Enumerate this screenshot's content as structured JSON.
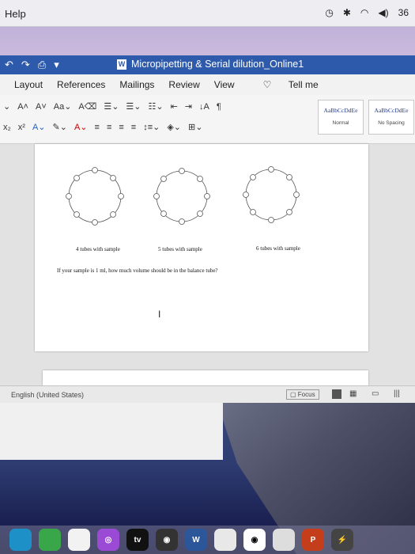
{
  "menubar": {
    "help": "Help",
    "battery": "36"
  },
  "titlebar": {
    "title": "Micropipetting & Serial dilution_Online1"
  },
  "tabs": [
    "Layout",
    "References",
    "Mailings",
    "Review",
    "View",
    "Tell me"
  ],
  "styles": [
    {
      "preview": "AaBbCcDdEe",
      "label": "Normal"
    },
    {
      "preview": "AaBbCcDdEe",
      "label": "No Spacing"
    }
  ],
  "document": {
    "captions": [
      "4 tubes with sample",
      "5 tubes with sample",
      "6 tubes with sample"
    ],
    "question": "If your sample is 1 ml, how much volume should be in the balance tube?"
  },
  "statusbar": {
    "language": "English (United States)",
    "focus": "Focus"
  },
  "dock": [
    "tv",
    "W",
    "P"
  ],
  "colors": {
    "title_blue": "#2e5aab",
    "menu_bg": "#eeeef2"
  }
}
